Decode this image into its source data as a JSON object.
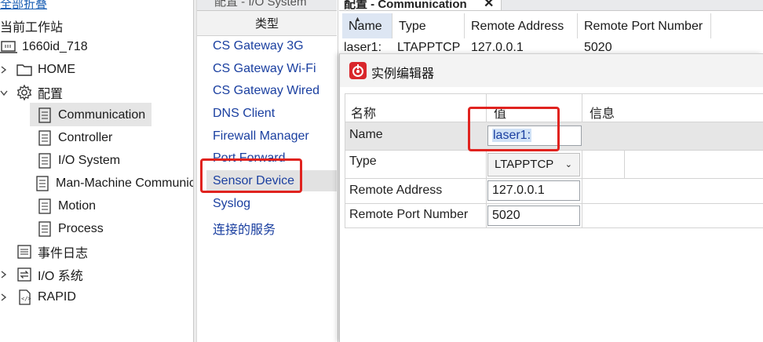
{
  "tree": {
    "top_link": "全部折叠",
    "section_label": "当前工作站",
    "station": "1660id_718",
    "items": [
      {
        "label": "HOME",
        "icon": "folder-icon"
      },
      {
        "label": "配置",
        "icon": "gear-icon"
      },
      {
        "label": "Communication",
        "icon": "document-icon",
        "selected": true
      },
      {
        "label": "Controller",
        "icon": "document-icon"
      },
      {
        "label": "I/O System",
        "icon": "document-icon"
      },
      {
        "label": "Man-Machine Communic",
        "icon": "document-icon"
      },
      {
        "label": "Motion",
        "icon": "document-icon"
      },
      {
        "label": "Process",
        "icon": "document-icon"
      },
      {
        "label": "事件日志",
        "icon": "event-log-icon"
      },
      {
        "label": "I/O 系统",
        "icon": "io-system-icon"
      },
      {
        "label": "RAPID",
        "icon": "rapid-icon"
      }
    ]
  },
  "type_panel": {
    "tab_label": "配置 - I/O System",
    "header": "类型",
    "items": [
      "CS Gateway 3G",
      "CS Gateway Wi-Fi",
      "CS Gateway Wired",
      "DNS Client",
      "Firewall Manager",
      "Port Forward",
      "Sensor Device",
      "Syslog",
      "连接的服务"
    ],
    "selected": "Sensor Device"
  },
  "comm_table": {
    "tab_label": "配置 - Communication",
    "tab_close": "✕",
    "columns": [
      "Name",
      "Type",
      "Remote Address",
      "Remote Port Number"
    ],
    "rows": [
      [
        "laser1:",
        "LTAPPTCP",
        "127.0.0.1",
        "5020"
      ]
    ]
  },
  "dialog": {
    "title": "实例编辑器",
    "columns": [
      "名称",
      "值",
      "信息"
    ],
    "fields": [
      {
        "label": "Name",
        "value": "laser1:"
      },
      {
        "label": "Type",
        "value": "LTAPPTCP"
      },
      {
        "label": "Remote Address",
        "value": "127.0.0.1"
      },
      {
        "label": "Remote Port Number",
        "value": "5020"
      }
    ]
  },
  "colors": {
    "highlight_red": "#e0231f",
    "link_blue": "#1a3fa0",
    "selection_gray": "#e2e2e2"
  }
}
